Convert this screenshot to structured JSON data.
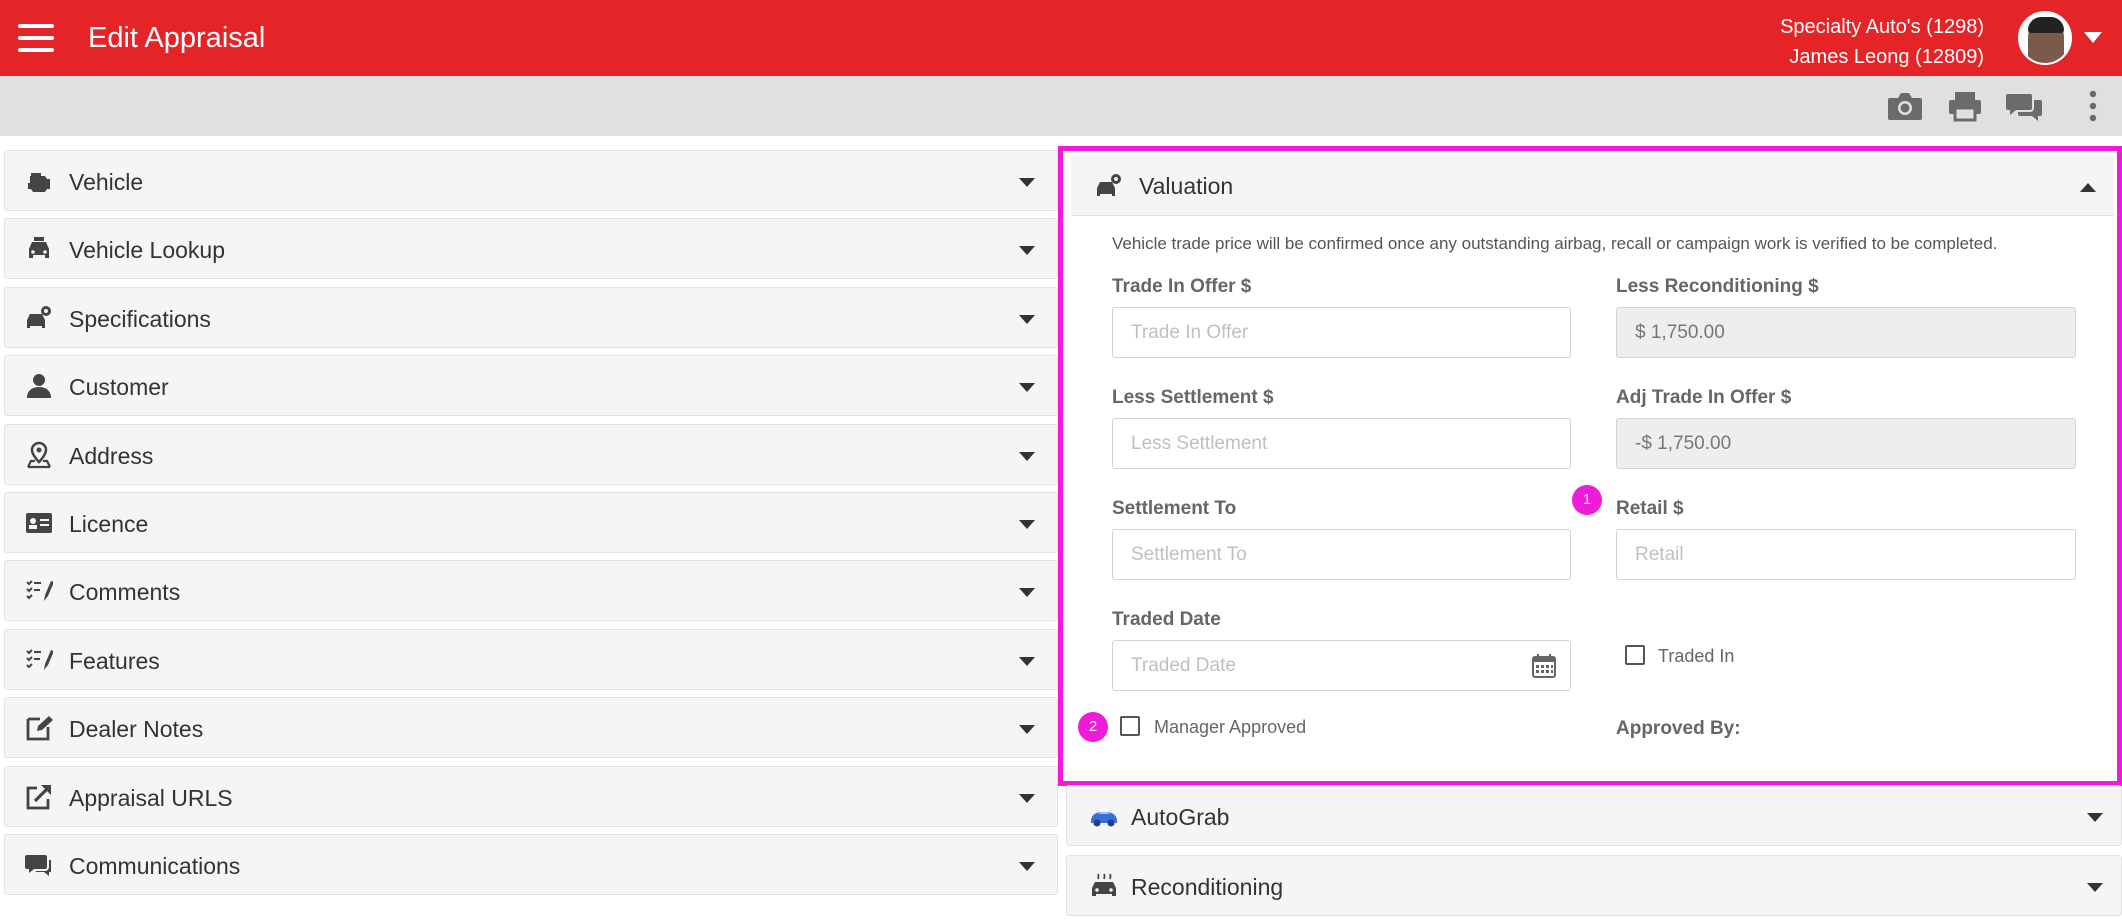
{
  "header": {
    "title": "Edit Appraisal",
    "dealer": "Specialty Auto's (1298)",
    "user": "James Leong (12809)"
  },
  "toolbar": {
    "icons": [
      "camera-icon",
      "print-icon",
      "chat-icon",
      "more-vertical-icon"
    ]
  },
  "sections": [
    {
      "label": "Vehicle",
      "icon": "engine-icon"
    },
    {
      "label": "Vehicle Lookup",
      "icon": "car-search-icon"
    },
    {
      "label": "Specifications",
      "icon": "car-gear-icon"
    },
    {
      "label": "Customer",
      "icon": "person-icon"
    },
    {
      "label": "Address",
      "icon": "map-pin-icon"
    },
    {
      "label": "Licence",
      "icon": "id-card-icon"
    },
    {
      "label": "Comments",
      "icon": "checklist-pen-icon"
    },
    {
      "label": "Features",
      "icon": "checklist-pen-icon"
    },
    {
      "label": "Dealer Notes",
      "icon": "edit-square-icon"
    },
    {
      "label": "Appraisal URLS",
      "icon": "external-link-icon"
    },
    {
      "label": "Communications",
      "icon": "chat-icon"
    }
  ],
  "valuation": {
    "title": "Valuation",
    "notice": "Vehicle trade price will be confirmed once any outstanding airbag, recall or campaign work is verified to be completed.",
    "trade_in_offer": {
      "label": "Trade In Offer $",
      "placeholder": "Trade In Offer",
      "value": ""
    },
    "less_reconditioning": {
      "label": "Less Reconditioning $",
      "value": "$ 1,750.00"
    },
    "less_settlement": {
      "label": "Less Settlement $",
      "placeholder": "Less Settlement",
      "value": ""
    },
    "adj_trade_in_offer": {
      "label": "Adj Trade In Offer $",
      "value": "-$ 1,750.00"
    },
    "settlement_to": {
      "label": "Settlement To",
      "placeholder": "Settlement To",
      "value": ""
    },
    "retail": {
      "label": "Retail $",
      "placeholder": "Retail",
      "value": ""
    },
    "traded_date": {
      "label": "Traded Date",
      "placeholder": "Traded Date",
      "value": ""
    },
    "traded_in": {
      "label": "Traded In",
      "checked": false
    },
    "manager_approved": {
      "label": "Manager Approved",
      "checked": false
    },
    "approved_by": {
      "label": "Approved By:"
    },
    "markers": [
      "1",
      "2"
    ]
  },
  "autograb": {
    "label": "AutoGrab",
    "icon": "autograb-car-icon"
  },
  "reconditioning": {
    "label": "Reconditioning",
    "icon": "car-wash-icon"
  },
  "colors": {
    "brand": "#e52427",
    "highlight": "#ee1bd8",
    "panel": "#f5f5f5"
  }
}
